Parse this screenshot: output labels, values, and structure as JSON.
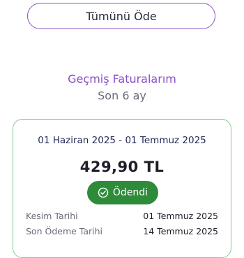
{
  "actions": {
    "pay_all_label": "Tümünü Öde"
  },
  "history": {
    "title": "Geçmiş Faturalarım",
    "subtitle": "Son 6 ay"
  },
  "bill": {
    "period": "01 Haziran 2025 - 01 Temmuz 2025",
    "amount": "429,90 TL",
    "status_label": "Ödendi",
    "status_icon": "check-circle-icon",
    "rows": [
      {
        "label": "Kesim Tarihi",
        "value": "01 Temmuz 2025"
      },
      {
        "label": "Son Ödeme Tarihi",
        "value": "14 Temmuz 2025"
      }
    ]
  },
  "colors": {
    "accent": "#8a4fc9",
    "card_border": "#7ccf8f",
    "paid_badge": "#2e8b3a"
  }
}
